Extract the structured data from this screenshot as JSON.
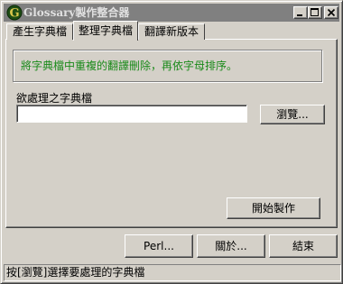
{
  "window": {
    "title": "Glossary製作整合器",
    "app_icon_letter": "G",
    "accent_color": "#808080"
  },
  "tabs": [
    {
      "label": "產生字典檔",
      "active": false
    },
    {
      "label": "整理字典檔",
      "active": true
    },
    {
      "label": "翻譯新版本",
      "active": false
    }
  ],
  "panel": {
    "info_text": "將字典檔中重複的翻譯刪除，再依字母排序。",
    "info_color": "#1a8a1a",
    "field_label": "欲處理之字典檔",
    "path_value": "",
    "browse_label": "瀏覽...",
    "start_label": "開始製作"
  },
  "footer": {
    "perl_label": "Perl...",
    "about_label": "關於...",
    "exit_label": "結束"
  },
  "status": {
    "text": "按[瀏覽]選擇要處理的字典檔"
  }
}
